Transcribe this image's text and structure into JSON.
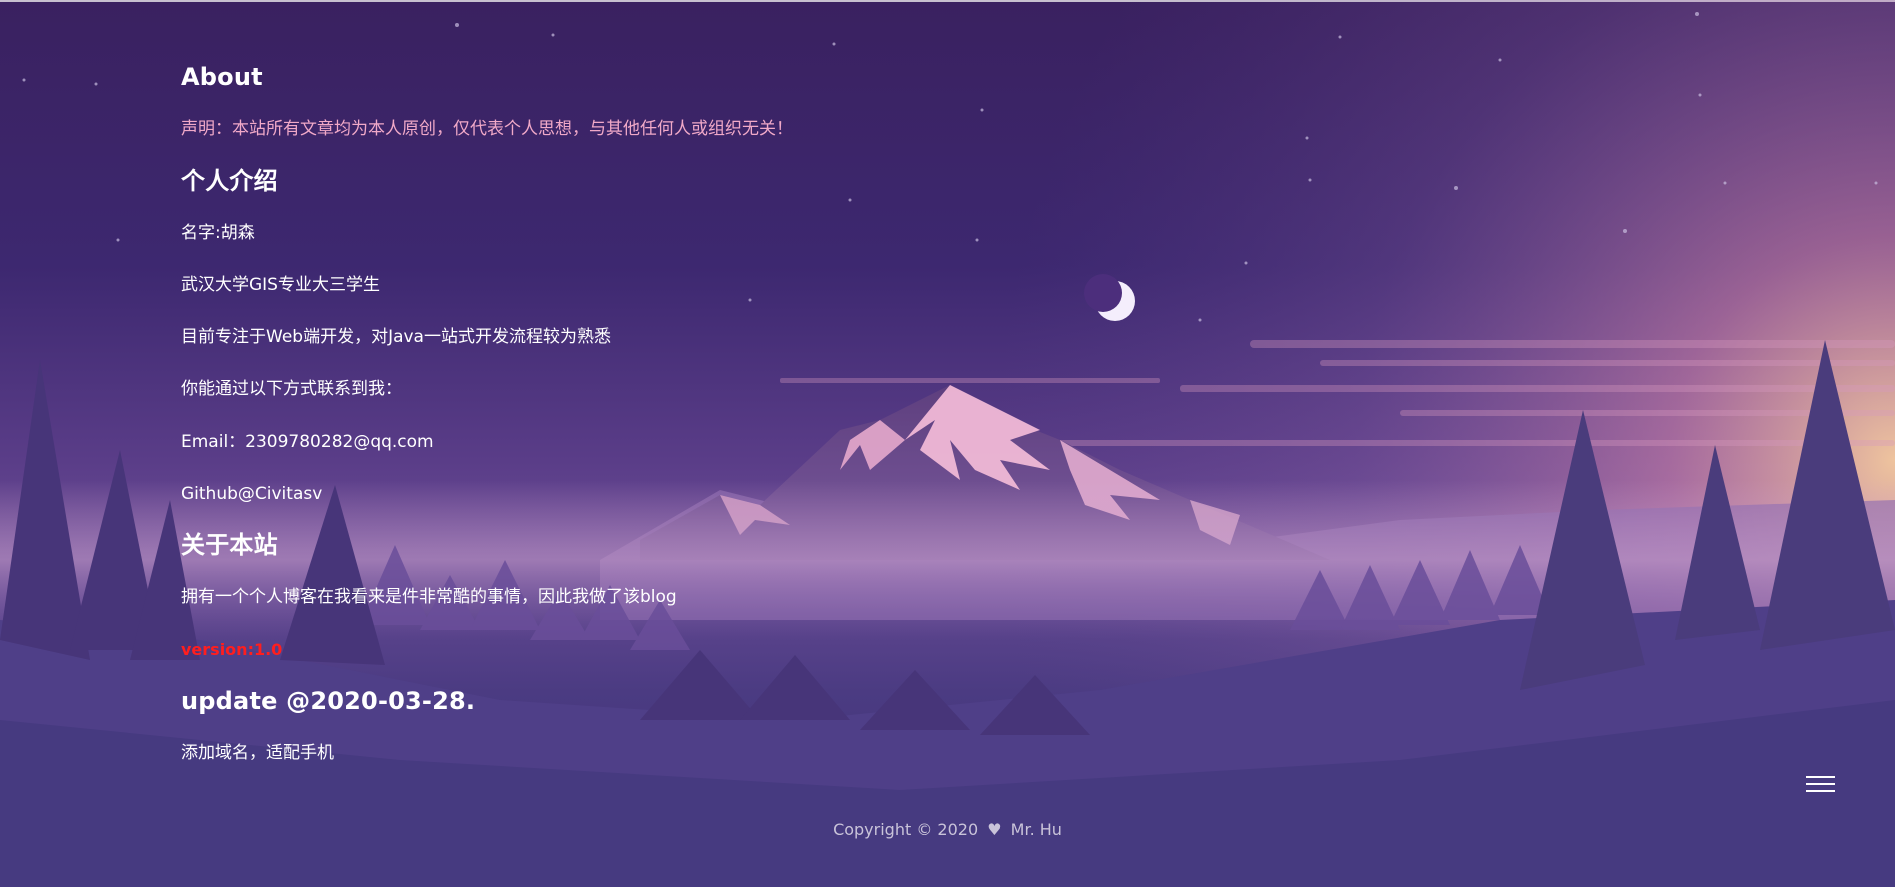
{
  "about": {
    "title": "About",
    "statement": "声明：本站所有文章均为本人原创，仅代表个人思想，与其他任何人或组织无关！"
  },
  "intro": {
    "title": "个人介绍",
    "name_line": "名字:胡森",
    "school_line": "武汉大学GIS专业大三学生",
    "focus_line": "目前专注于Web端开发，对Java一站式开发流程较为熟悉",
    "contact_line": "你能通过以下方式联系到我：",
    "email_line": "Email：2309780282@qq.com",
    "github_line": "Github@Civitasv"
  },
  "site": {
    "title": "关于本站",
    "desc_line": "拥有一个个人博客在我看来是件非常酷的事情，因此我做了该blog",
    "version": "version:1.0"
  },
  "update": {
    "title": "update @2020-03-28.",
    "desc_line": "添加域名，适配手机"
  },
  "footer": {
    "copyright": "Copyright © 2020",
    "author": "Mr. Hu"
  },
  "icons": {
    "heart": "heart-icon",
    "menu": "menu-icon"
  },
  "colors": {
    "pink_text": "#f1a9c8",
    "version_red": "#ff1e1e"
  }
}
